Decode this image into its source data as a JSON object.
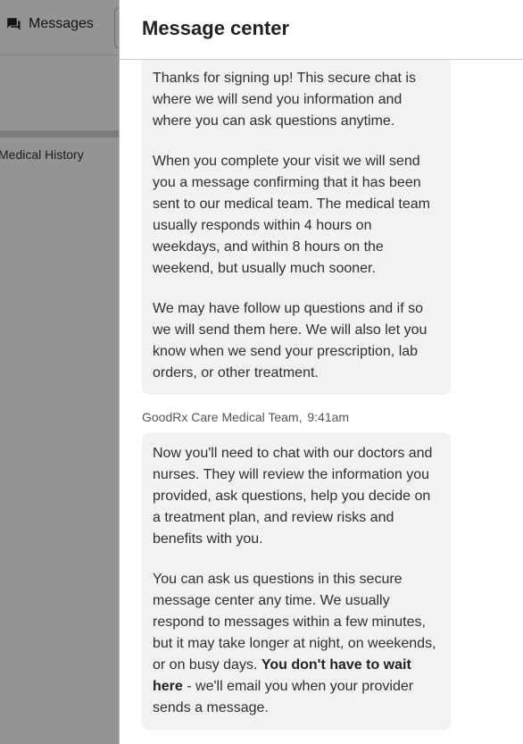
{
  "background": {
    "tab_label": "Messages",
    "side_link": "Medical History"
  },
  "drawer": {
    "title": "Message center"
  },
  "messages": [
    {
      "paragraphs": [
        "Thanks for signing up! This secure chat is where we will send you information and where you can ask questions anytime.",
        "When you complete your visit we will send you a message confirming that it has been sent to our medical team. The medical team usually responds within 4 hours on weekdays, and within 8 hours on the weekend, but usually much sooner.",
        "We may have follow up questions and if so we will send them here. We will also let you know when we send your prescription, lab orders, or other treatment."
      ]
    },
    {
      "sender": "GoodRx Care Medical Team,",
      "time": "9:41am",
      "paragraphs": [
        "Now you'll need to chat with our doctors and nurses. They will review the information you provided, ask questions, help you decide on a treatment plan, and review risks and benefits with you."
      ],
      "p2_before": "You can ask us questions in this secure message center any time. We usually respond to messages within a few minutes, but it may take longer at night, on weekends, or on busy days. ",
      "p2_bold": "You don't have to wait here",
      "p2_after": " - we'll email you when your provider sends a message."
    }
  ]
}
